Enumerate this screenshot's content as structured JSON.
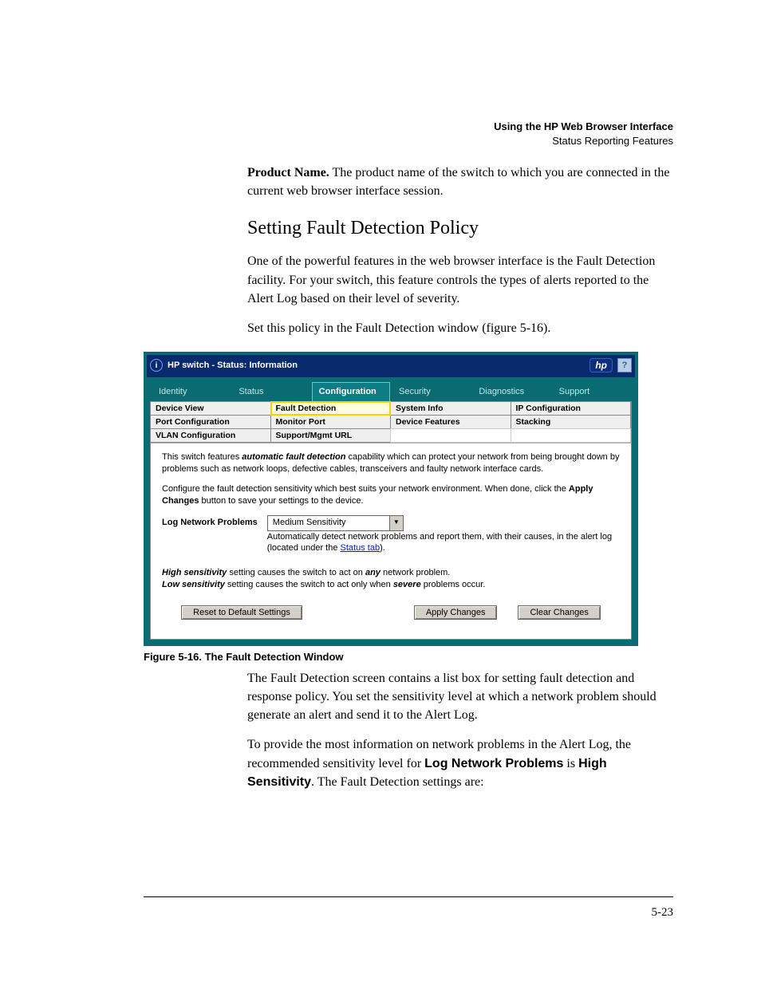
{
  "runningHead": {
    "title": "Using the HP Web Browser Interface",
    "subtitle": "Status Reporting Features"
  },
  "para1": {
    "lead": "Product Name.",
    "rest": " The product name of the switch to which you are connected in the current web browser interface session."
  },
  "heading": "Setting Fault Detection Policy",
  "para2": "One of the powerful features in the web browser interface is the Fault Detection facility. For your switch, this feature controls the types of alerts reported to the Alert Log based on their level of severity.",
  "para3": "Set this policy in the Fault Detection window (figure 5-16).",
  "figureCaption": "Figure 5-16. The Fault Detection Window",
  "shot": {
    "title": "HP switch - Status: Information",
    "hpBadge": "hp",
    "help": "?",
    "mainTabs": [
      "Identity",
      "Status",
      "Configuration",
      "Security",
      "Diagnostics",
      "Support"
    ],
    "mainActiveIndex": 2,
    "subTabs": [
      [
        "Device View",
        "Fault Detection",
        "System Info",
        "IP Configuration"
      ],
      [
        "Port Configuration",
        "Monitor Port",
        "Device Features",
        "Stacking"
      ],
      [
        "VLAN Configuration",
        "Support/Mgmt URL",
        "",
        ""
      ]
    ],
    "subActive": {
      "row": 0,
      "col": 1
    },
    "body": {
      "p1a": "This switch features ",
      "p1b": "automatic fault detection",
      "p1c": " capability which can protect your network from being brought down by problems such as network loops, defective cables, transceivers and faulty network interface cards.",
      "p2a": "Configure the fault detection sensitivity which best suits your network environment. When done, click the ",
      "p2b": "Apply Changes",
      "p2c": " button to save your settings to the device.",
      "fieldLabel": "Log Network Problems",
      "comboValue": "Medium Sensitivity",
      "helperA": "Automatically detect network problems and report them, with their causes, in the alert log (located under the ",
      "helperLink": "Status tab",
      "helperB": ").",
      "noteHigh1": "High sensitivity",
      "noteHigh2": " setting causes the switch to act on ",
      "noteHigh3": "any",
      "noteHigh4": " network problem.",
      "noteLow1": "Low sensitivity",
      "noteLow2": " setting causes the switch to act only when ",
      "noteLow3": "severe",
      "noteLow4": " problems occur.",
      "btnReset": "Reset to Default Settings",
      "btnApply": "Apply Changes",
      "btnClear": "Clear Changes"
    }
  },
  "para4": "The Fault Detection screen contains a list box for setting fault detection and response policy. You set the sensitivity level at which a network problem should generate an alert and send it to the Alert Log.",
  "para5": {
    "a": "To provide the most information on network problems in the Alert Log, the recommended sensitivity level for ",
    "b": "Log Network Problems",
    "c": " is ",
    "d": "High Sensitivity",
    "e": ". The Fault Detection settings are:"
  },
  "pageNumber": "5-23",
  "glyphs": {
    "info": "i",
    "dropdown": "▼"
  }
}
